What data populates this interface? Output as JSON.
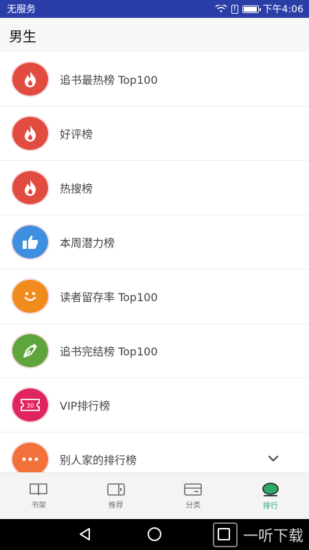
{
  "statusbar": {
    "carrier": "无服务",
    "time": "下午4:06",
    "battery_level": 0.95
  },
  "header": {
    "title": "男生"
  },
  "rankings": [
    {
      "label": "追书最热榜 Top100",
      "icon": "flame-icon",
      "color": "#e24b3f"
    },
    {
      "label": "好评榜",
      "icon": "flame-icon",
      "color": "#e24b3f"
    },
    {
      "label": "热搜榜",
      "icon": "flame-icon",
      "color": "#e24b3f"
    },
    {
      "label": "本周潜力榜",
      "icon": "thumbs-up-icon",
      "color": "#3f8fe0"
    },
    {
      "label": "读者留存率 Top100",
      "icon": "smiley-icon",
      "color": "#f28b1e"
    },
    {
      "label": "追书完结榜 Top100",
      "icon": "pen-nib-icon",
      "color": "#5ea63b"
    },
    {
      "label": "VIP排行榜",
      "icon": "ticket-icon",
      "color": "#e0245e",
      "ticket_text": "30"
    },
    {
      "label": "别人家的排行榜",
      "icon": "more-icon",
      "color": "#f2703a"
    }
  ],
  "tabs": [
    {
      "label": "书架",
      "icon": "book-icon",
      "active": false
    },
    {
      "label": "推荐",
      "icon": "recommend-icon",
      "active": false
    },
    {
      "label": "分类",
      "icon": "category-icon",
      "active": false
    },
    {
      "label": "排行",
      "icon": "ranking-icon",
      "active": true
    }
  ],
  "colors": {
    "accent": "#2ea86b",
    "statusbar": "#2b3ea8"
  },
  "watermark": {
    "text": "一听下载"
  }
}
